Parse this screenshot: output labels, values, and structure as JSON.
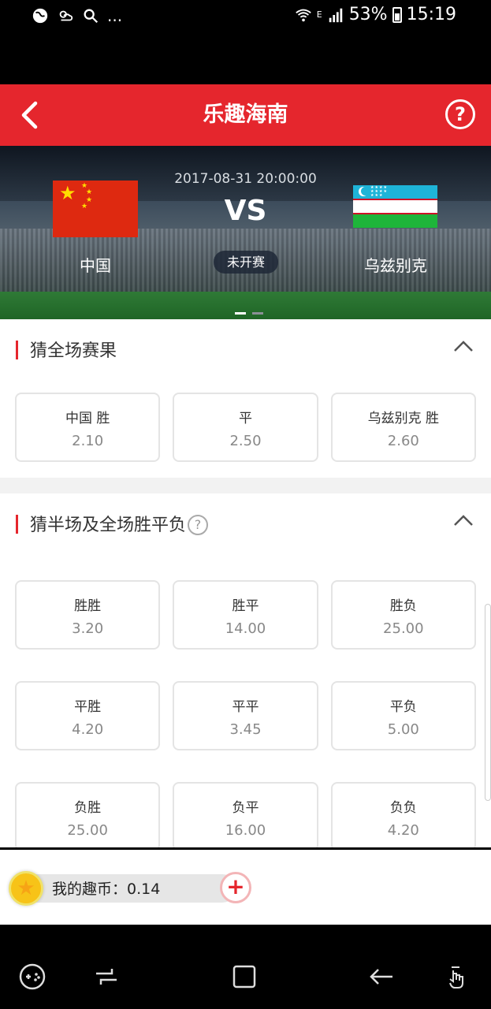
{
  "status_bar": {
    "battery": "53%",
    "time": "15:19",
    "network": "E",
    "more": "..."
  },
  "header": {
    "title": "乐趣海南"
  },
  "match": {
    "datetime": "2017-08-31 20:00:00",
    "vs": "VS",
    "home_team": "中国",
    "away_team": "乌兹别克",
    "status": "未开赛"
  },
  "section_full": {
    "title": "猜全场赛果",
    "options": [
      {
        "label": "中国 胜",
        "odds": "2.10"
      },
      {
        "label": "平",
        "odds": "2.50"
      },
      {
        "label": "乌兹别克 胜",
        "odds": "2.60"
      }
    ]
  },
  "section_half": {
    "title": "猜半场及全场胜平负",
    "help": "?",
    "rows": [
      [
        {
          "label": "胜胜",
          "odds": "3.20"
        },
        {
          "label": "胜平",
          "odds": "14.00"
        },
        {
          "label": "胜负",
          "odds": "25.00"
        }
      ],
      [
        {
          "label": "平胜",
          "odds": "4.20"
        },
        {
          "label": "平平",
          "odds": "3.45"
        },
        {
          "label": "平负",
          "odds": "5.00"
        }
      ],
      [
        {
          "label": "负胜",
          "odds": "25.00"
        },
        {
          "label": "负平",
          "odds": "16.00"
        },
        {
          "label": "负负",
          "odds": "4.20"
        }
      ]
    ]
  },
  "coins": {
    "label": "我的趣币：0.14"
  },
  "colors": {
    "brand_red": "#e5262d",
    "odds_text": "#888888"
  }
}
